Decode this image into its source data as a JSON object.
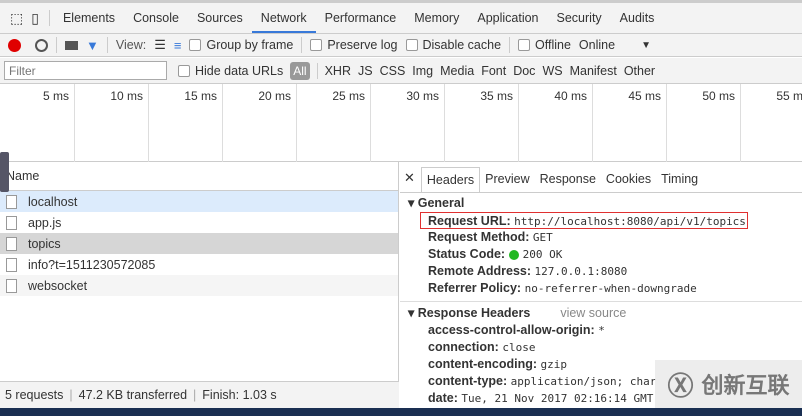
{
  "panel_tabs": [
    "Elements",
    "Console",
    "Sources",
    "Network",
    "Performance",
    "Memory",
    "Application",
    "Security",
    "Audits"
  ],
  "toolbar": {
    "view_label": "View:",
    "group_by_frame": "Group by frame",
    "preserve_log": "Preserve log",
    "disable_cache": "Disable cache",
    "offline": "Offline",
    "throttle": "Online"
  },
  "filterbar": {
    "placeholder": "Filter",
    "hide_data_urls": "Hide data URLs",
    "types": [
      "All",
      "XHR",
      "JS",
      "CSS",
      "Img",
      "Media",
      "Font",
      "Doc",
      "WS",
      "Manifest",
      "Other"
    ]
  },
  "timeline_ticks": [
    "5 ms",
    "10 ms",
    "15 ms",
    "20 ms",
    "25 ms",
    "30 ms",
    "35 ms",
    "40 ms",
    "45 ms",
    "50 ms",
    "55 ms"
  ],
  "requests": {
    "header": "Name",
    "rows": [
      "localhost",
      "app.js",
      "topics",
      "info?t=1511230572085",
      "websocket"
    ]
  },
  "status": {
    "requests": "5 requests",
    "transferred": "47.2 KB transferred",
    "finish": "Finish: 1.03 s"
  },
  "detail": {
    "tabs": [
      "Headers",
      "Preview",
      "Response",
      "Cookies",
      "Timing"
    ],
    "general_title": "General",
    "general": [
      {
        "k": "Request URL:",
        "v": "http://localhost:8080/api/v1/topics"
      },
      {
        "k": "Request Method:",
        "v": "GET"
      },
      {
        "k": "Status Code:",
        "v": "200 OK"
      },
      {
        "k": "Remote Address:",
        "v": "127.0.0.1:8080"
      },
      {
        "k": "Referrer Policy:",
        "v": "no-referrer-when-downgrade"
      }
    ],
    "response_title": "Response Headers",
    "view_source": "view source",
    "response": [
      {
        "k": "access-control-allow-origin:",
        "v": "*"
      },
      {
        "k": "connection:",
        "v": "close"
      },
      {
        "k": "content-encoding:",
        "v": "gzip"
      },
      {
        "k": "content-type:",
        "v": "application/json; char"
      },
      {
        "k": "date:",
        "v": "Tue, 21 Nov 2017 02:16:14 GMT"
      }
    ]
  },
  "watermark": "创新互联",
  "colors": {
    "record": "#e00000",
    "accent": "#3879d9",
    "status_ok": "#22b822",
    "highlight_box": "#e03030",
    "selected_row": "#d6d6d6",
    "hover_row": "#dcebfc"
  }
}
